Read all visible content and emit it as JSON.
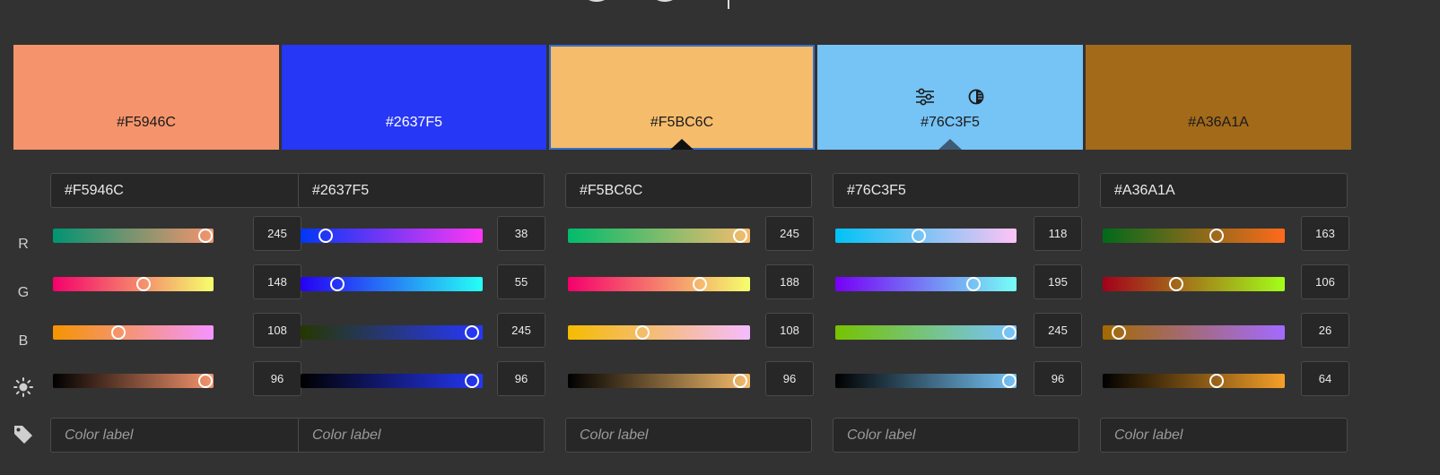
{
  "row_labels": {
    "r": "R",
    "g": "G",
    "b": "B"
  },
  "icons": {
    "brightness": "brightness-icon",
    "tag": "tag-icon",
    "adjust": "sliders-icon",
    "contrast": "contrast-icon"
  },
  "swatches": [
    {
      "hex": "#F5946C",
      "color": "#F5946C",
      "text_color": "#1a1a1a"
    },
    {
      "hex": "#2637F5",
      "color": "#2637F5",
      "text_color": "#ffffff"
    },
    {
      "hex": "#F5BC6C",
      "color": "#F5BC6C",
      "text_color": "#1a1a1a"
    },
    {
      "hex": "#76C3F5",
      "color": "#76C3F5",
      "text_color": "#1a1a1a"
    },
    {
      "hex": "#A36A1A",
      "color": "#A36A1A",
      "text_color": "#1a1a1a"
    }
  ],
  "columns": [
    {
      "hex_value": "#F5946C",
      "r": "245",
      "g": "148",
      "b": "108",
      "brightness": "96",
      "label_placeholder": "Color label"
    },
    {
      "hex_value": "#2637F5",
      "r": "38",
      "g": "55",
      "b": "245",
      "brightness": "96",
      "label_placeholder": "Color label"
    },
    {
      "hex_value": "#F5BC6C",
      "r": "245",
      "g": "188",
      "b": "108",
      "brightness": "96",
      "label_placeholder": "Color label"
    },
    {
      "hex_value": "#76C3F5",
      "r": "118",
      "g": "195",
      "b": "245",
      "brightness": "96",
      "label_placeholder": "Color label"
    },
    {
      "hex_value": "#A36A1A",
      "r": "163",
      "g": "106",
      "b": "26",
      "brightness": "64",
      "label_placeholder": "Color label"
    }
  ]
}
